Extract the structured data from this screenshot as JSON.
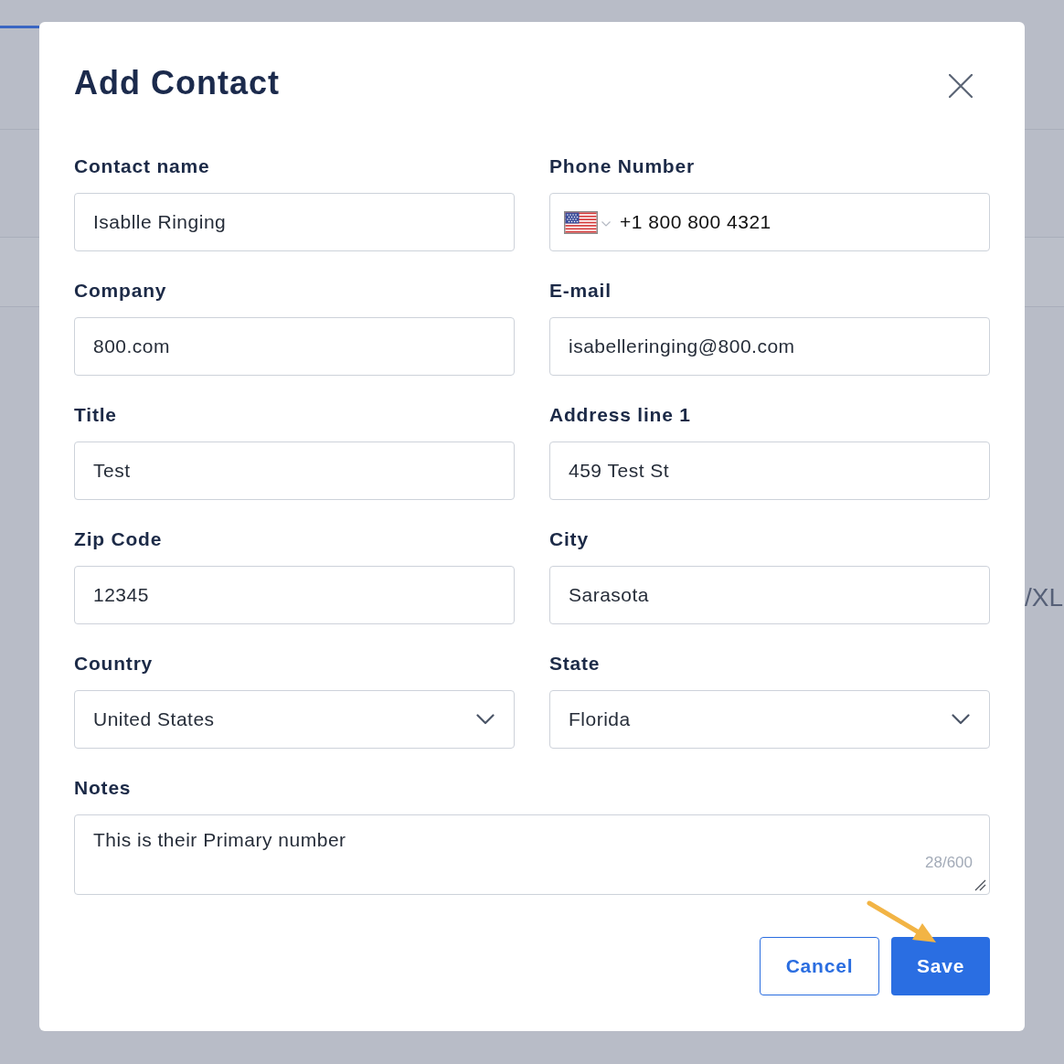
{
  "background": {
    "text": "/XL"
  },
  "dialog": {
    "title": "Add Contact"
  },
  "fields": [
    {
      "label": "Contact name",
      "kind": "text",
      "value": "Isablle Ringing"
    },
    {
      "label": "Phone Number",
      "kind": "phone",
      "value": "+1 800 800 4321"
    },
    {
      "label": "Company",
      "kind": "text",
      "value": "800.com"
    },
    {
      "label": "E-mail",
      "kind": "text",
      "value": "isabelleringing@800.com"
    },
    {
      "label": "Title",
      "kind": "text",
      "value": "Test"
    },
    {
      "label": "Address line 1",
      "kind": "text",
      "value": "459 Test St"
    },
    {
      "label": "Zip Code",
      "kind": "text",
      "value": "12345"
    },
    {
      "label": "City",
      "kind": "text",
      "value": "Sarasota"
    },
    {
      "label": "Country",
      "kind": "select",
      "value": "United States"
    },
    {
      "label": "State",
      "kind": "select",
      "value": "Florida"
    }
  ],
  "notes": {
    "label": "Notes",
    "value": "This is their Primary number",
    "counter": "28/600"
  },
  "buttons": [
    {
      "label": "Cancel",
      "kind": "secondary"
    },
    {
      "label": "Save",
      "kind": "primary"
    }
  ],
  "annotation_arrow": true
}
